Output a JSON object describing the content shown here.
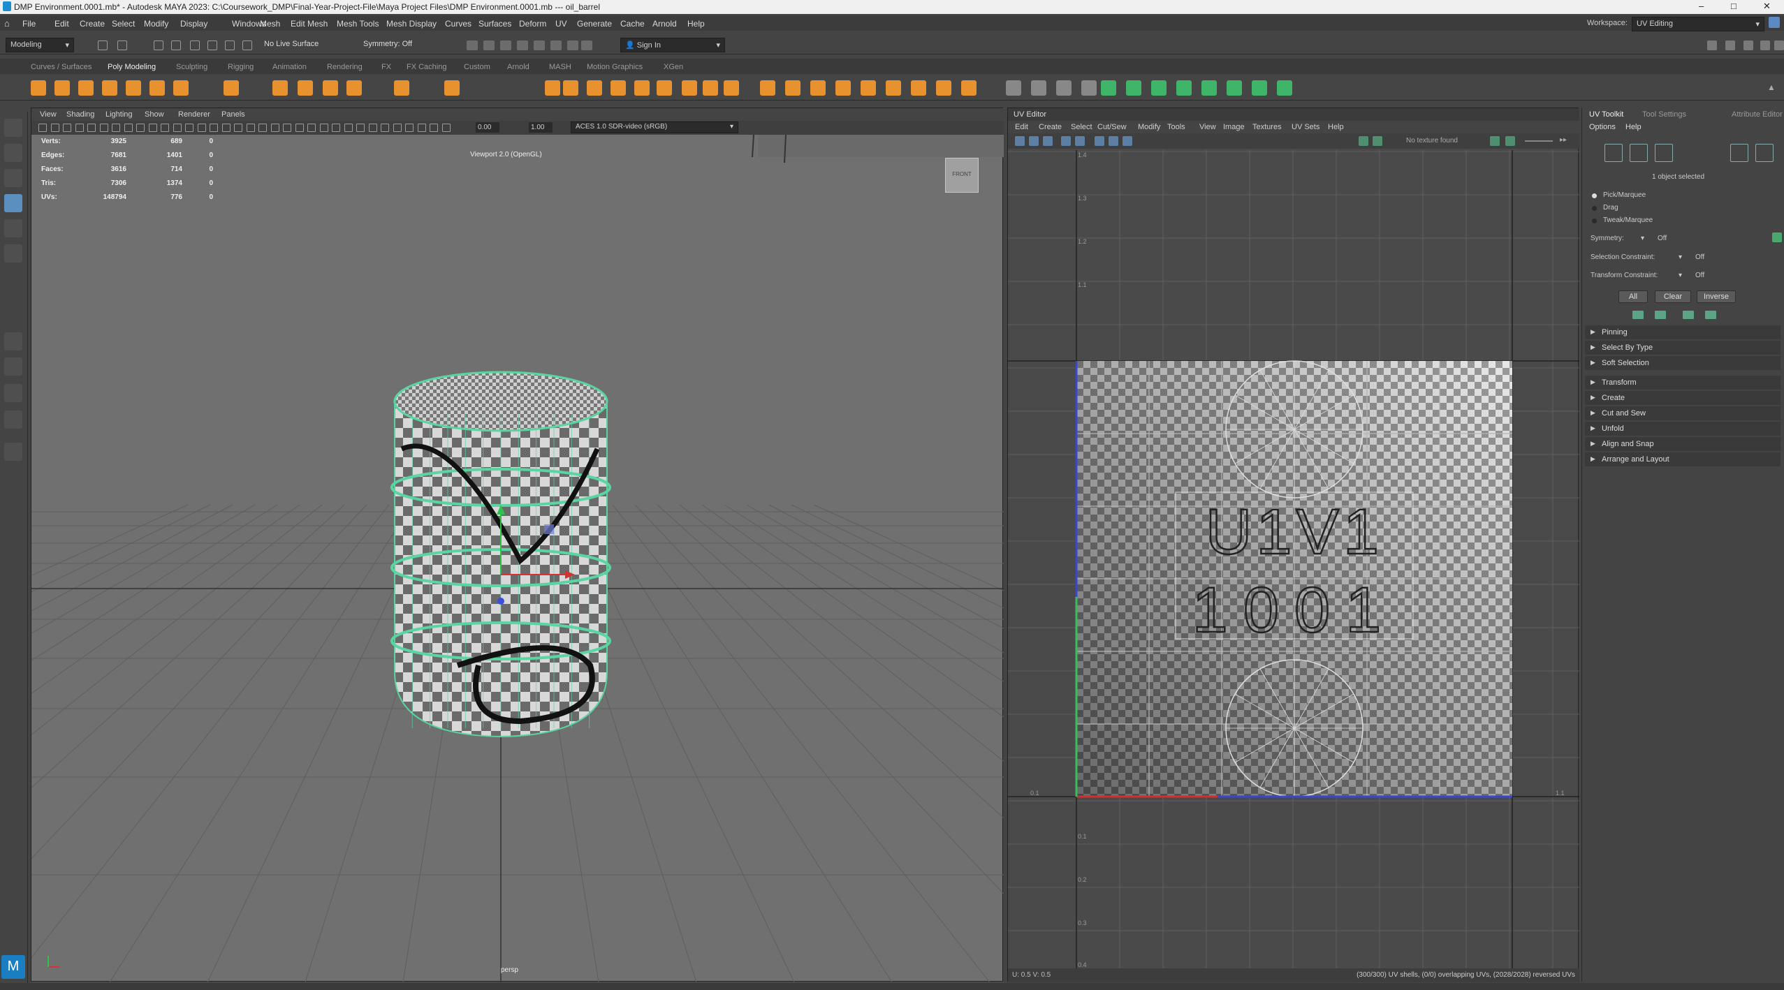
{
  "title": "DMP Environment.0001.mb* - Autodesk MAYA 2023: C:\\Coursework_DMP\\Final-Year-Project-File\\Maya Project Files\\DMP Environment.0001.mb   ---   oil_barrel",
  "window_controls": {
    "minimize": "–",
    "maximize": "□",
    "close": "✕"
  },
  "workspace": {
    "label": "Workspace:",
    "value": "UV Editing"
  },
  "menus": [
    "File",
    "Edit",
    "Create",
    "Select",
    "Modify",
    "Display",
    "Windows",
    "Mesh",
    "Edit Mesh",
    "Mesh Tools",
    "Mesh Display",
    "Curves",
    "Surfaces",
    "Deform",
    "UV",
    "Generate",
    "Cache",
    "Arnold",
    "Help"
  ],
  "status_line": {
    "mode": "Modeling",
    "live_surface": "No Live Surface",
    "symmetry": "Symmetry: Off",
    "sign_in": "Sign In"
  },
  "shelf_tabs": [
    "Curves / Surfaces",
    "Poly Modeling",
    "Sculpting",
    "Rigging",
    "Animation",
    "Rendering",
    "FX",
    "FX Caching",
    "Custom",
    "Arnold",
    "MASH",
    "Motion Graphics",
    "XGen"
  ],
  "shelf_active": "Poly Modeling",
  "viewport": {
    "menus": [
      "View",
      "Shading",
      "Lighting",
      "Show",
      "Renderer",
      "Panels"
    ],
    "field1": "0.00",
    "field2": "1.00",
    "color_space": "ACES 1.0 SDR-video (sRGB)",
    "renderer_label": "Viewport 2.0 (OpenGL)",
    "camera": "persp",
    "view_cube": "FRONT",
    "hud": [
      {
        "label": "Verts:",
        "a": "3925",
        "b": "689",
        "c": "0"
      },
      {
        "label": "Edges:",
        "a": "7681",
        "b": "1401",
        "c": "0"
      },
      {
        "label": "Faces:",
        "a": "3616",
        "b": "714",
        "c": "0"
      },
      {
        "label": "Tris:",
        "a": "7306",
        "b": "1374",
        "c": "0"
      },
      {
        "label": "UVs:",
        "a": "148794",
        "b": "776",
        "c": "0"
      }
    ]
  },
  "uv_editor": {
    "title": "UV Editor",
    "menus": [
      "Edit",
      "Create",
      "Select",
      "Cut/Sew",
      "Modify",
      "Tools",
      "View",
      "Image",
      "Textures",
      "UV Sets",
      "Help"
    ],
    "texture_status": "No texture found",
    "udim_label_1": "U1V1",
    "udim_label_2": "1001",
    "uv_coord": "U: 0.5 V: 0.5",
    "status": "(300/300) UV shells, (0/0) overlapping UVs, (2028/2028) reversed UVs",
    "axis_left": [
      "1.4",
      "1.3",
      "1.2",
      "1.1",
      "0.1",
      "0.2",
      "0.3",
      "0.4"
    ],
    "axis_labels_corner": [
      "0.1",
      "1.1"
    ]
  },
  "toolkit": {
    "tabs": [
      "UV Toolkit",
      "Tool Settings",
      "Attribute Editor"
    ],
    "menus": [
      "Options",
      "Help"
    ],
    "selected": "1 object selected",
    "modes": [
      "Pick/Marquee",
      "Drag",
      "Tweak/Marquee"
    ],
    "symmetry_label": "Symmetry:",
    "symmetry_value": "Off",
    "sel_constraint_label": "Selection Constraint:",
    "sel_constraint_value": "Off",
    "tr_constraint_label": "Transform Constraint:",
    "tr_constraint_value": "Off",
    "buttons": [
      "All",
      "Clear",
      "Inverse"
    ],
    "sections_a": [
      "Pinning",
      "Select By Type",
      "Soft Selection"
    ],
    "sections_b": [
      "Transform",
      "Create",
      "Cut and Sew",
      "Unfold",
      "Align and Snap",
      "Arrange and Layout"
    ]
  },
  "colors": {
    "accent": "#5ad4a0",
    "shelf_orange": "#e7922f",
    "shelf_green": "#3fb56a",
    "uv_red": "#d03030",
    "uv_blue": "#3a46d0"
  }
}
